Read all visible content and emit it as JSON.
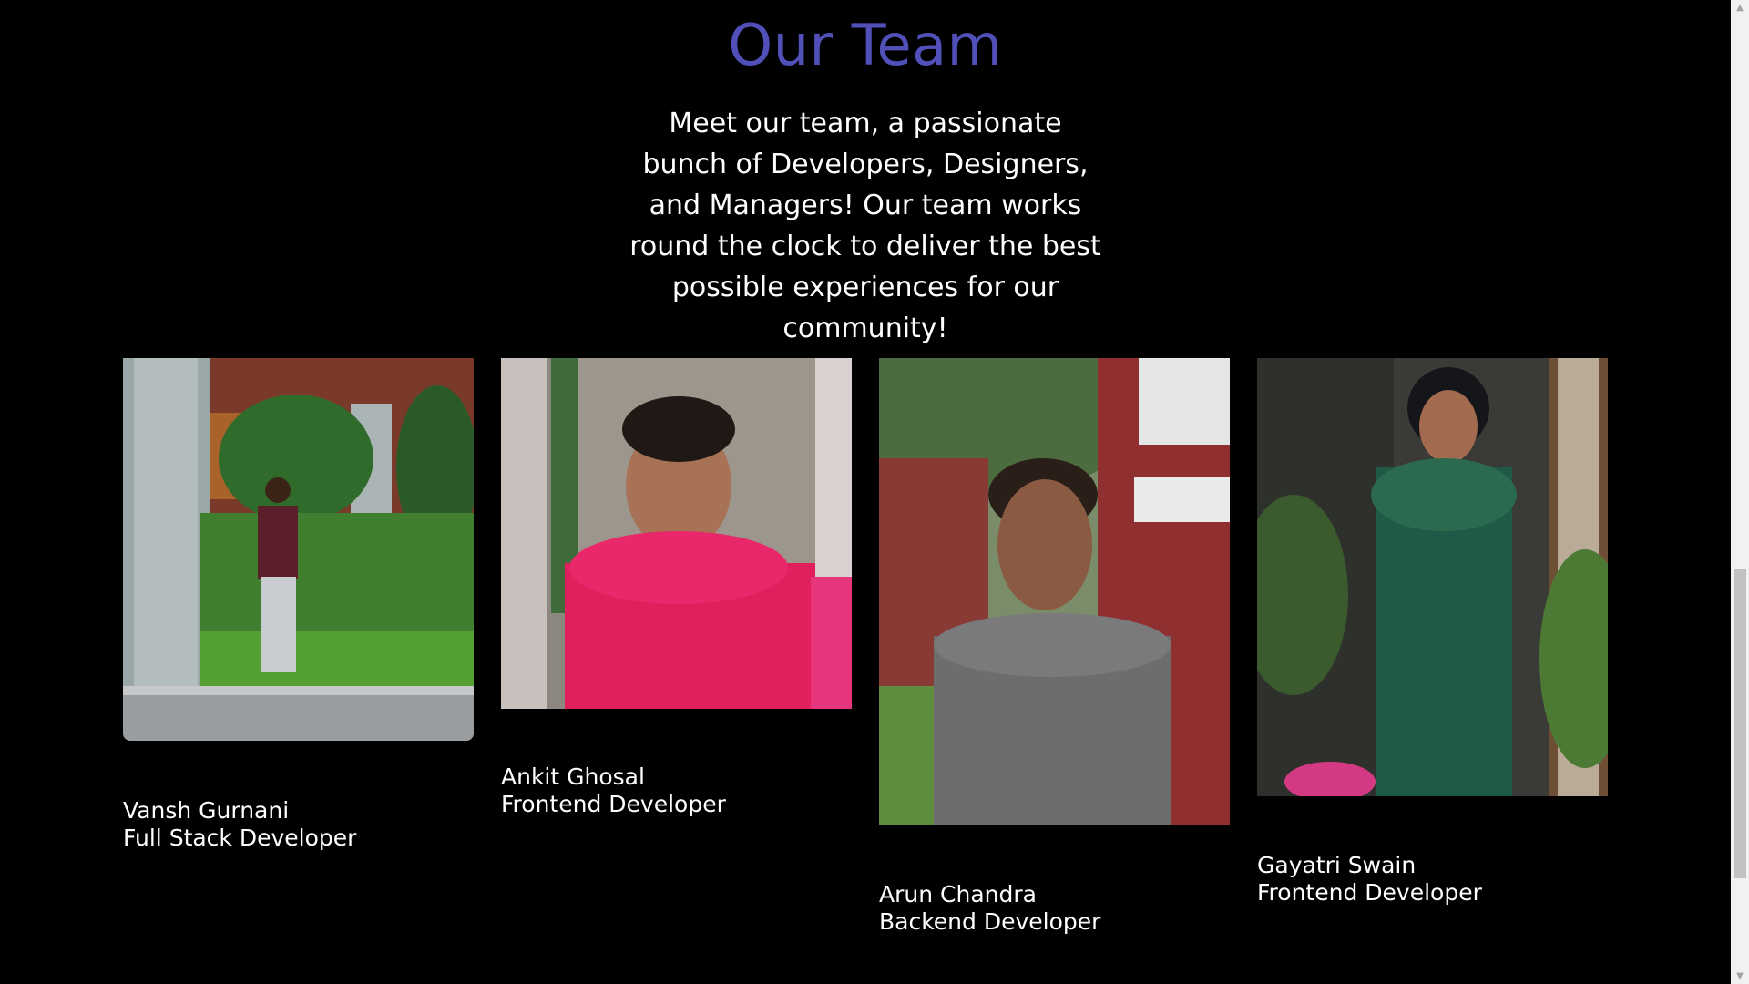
{
  "section": {
    "title": "Our Team",
    "description": "Meet our team, a passionate bunch of Developers, Designers, and Managers! Our team works round the clock to deliver the best possible experiences for our community!"
  },
  "team": [
    {
      "name": "Vansh Gurnani",
      "role": "Full Stack Developer"
    },
    {
      "name": "Ankit Ghosal",
      "role": "Frontend Developer"
    },
    {
      "name": "Arun Chandra",
      "role": "Backend Developer"
    },
    {
      "name": "Gayatri Swain",
      "role": "Frontend Developer"
    }
  ],
  "colors": {
    "background": "#000000",
    "heading": "#5050b8",
    "text": "#ffffff"
  }
}
